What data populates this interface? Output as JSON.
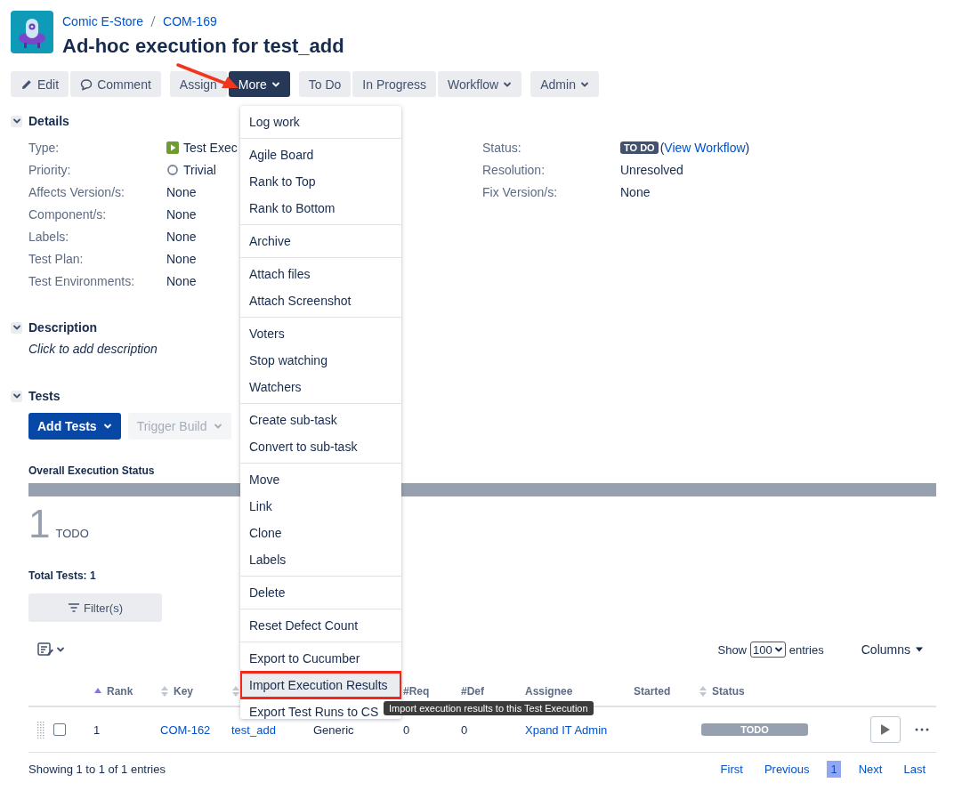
{
  "breadcrumbs": [
    "Comic E-Store",
    "COM-169"
  ],
  "title": "Ad-hoc execution for test_add",
  "toolbar": [
    {
      "buttons": [
        {
          "label": "Edit",
          "kind": "edit"
        },
        {
          "label": "Comment",
          "kind": "comment"
        }
      ]
    },
    {
      "buttons": [
        {
          "label": "Assign",
          "kind": "plain"
        },
        {
          "label": "More",
          "kind": "dropdown",
          "open": true
        }
      ]
    },
    {
      "buttons": [
        {
          "label": "To Do",
          "kind": "plain"
        },
        {
          "label": "In Progress",
          "kind": "plain"
        },
        {
          "label": "Workflow",
          "kind": "dropdown",
          "open": false
        }
      ]
    },
    {
      "buttons": [
        {
          "label": "Admin",
          "kind": "dropdown",
          "open": false
        }
      ]
    }
  ],
  "more_menu": [
    {
      "items": [
        {
          "label": "Log work",
          "highlighted": false
        }
      ]
    },
    {
      "items": [
        {
          "label": "Agile Board",
          "highlighted": false
        },
        {
          "label": "Rank to Top",
          "highlighted": false
        },
        {
          "label": "Rank to Bottom",
          "highlighted": false
        }
      ]
    },
    {
      "items": [
        {
          "label": "Archive",
          "highlighted": false
        }
      ]
    },
    {
      "items": [
        {
          "label": "Attach files",
          "highlighted": false
        },
        {
          "label": "Attach Screenshot",
          "highlighted": false
        }
      ]
    },
    {
      "items": [
        {
          "label": "Voters",
          "highlighted": false
        },
        {
          "label": "Stop watching",
          "highlighted": false
        },
        {
          "label": "Watchers",
          "highlighted": false
        }
      ]
    },
    {
      "items": [
        {
          "label": "Create sub-task",
          "highlighted": false
        },
        {
          "label": "Convert to sub-task",
          "highlighted": false
        }
      ]
    },
    {
      "items": [
        {
          "label": "Move",
          "highlighted": false
        },
        {
          "label": "Link",
          "highlighted": false
        },
        {
          "label": "Clone",
          "highlighted": false
        },
        {
          "label": "Labels",
          "highlighted": false
        }
      ]
    },
    {
      "items": [
        {
          "label": "Delete",
          "highlighted": false
        }
      ]
    },
    {
      "items": [
        {
          "label": "Reset Defect Count",
          "highlighted": false
        }
      ]
    },
    {
      "items": [
        {
          "label": "Export to Cucumber",
          "highlighted": false
        },
        {
          "label": "Import Execution Results",
          "highlighted": true
        },
        {
          "label": "Export Test Runs to CS",
          "highlighted": false
        }
      ]
    }
  ],
  "tooltip": "Import execution results to this Test Execution",
  "details": {
    "title": "Details",
    "expanded": true,
    "left": [
      {
        "label": "Type:",
        "value": "Test Exec",
        "kind": "issue-type"
      },
      {
        "label": "Priority:",
        "value": "Trivial",
        "kind": "priority"
      },
      {
        "label": "Affects Version/s:",
        "value": "None"
      },
      {
        "label": "Component/s:",
        "value": "None"
      },
      {
        "label": "Labels:",
        "value": "None"
      },
      {
        "label": "Test Plan:",
        "value": "None"
      },
      {
        "label": "Test Environments:",
        "value": "None"
      }
    ],
    "right": [
      {
        "label": "Status:",
        "kind": "status",
        "value": "TO DO",
        "prefix": "(",
        "link": "View Workflow",
        "suffix": ")"
      },
      {
        "label": "Resolution:",
        "kind": "text",
        "value": "Unresolved"
      },
      {
        "label": "Fix Version/s:",
        "kind": "text",
        "value": "None"
      }
    ]
  },
  "description": {
    "title": "Description",
    "expanded": true,
    "text": "Click to add description"
  },
  "tests": {
    "title": "Tests",
    "expanded": true,
    "buttons": [
      {
        "label": "Add Tests",
        "kind": "primary"
      },
      {
        "label": "Trigger Build",
        "kind": "disabled"
      }
    ],
    "overall_title": "Overall Execution Status",
    "overall_bar": [
      {
        "level": 1,
        "color": "#97a0af"
      }
    ],
    "count": "1",
    "count_label": "TODO",
    "total": "Total Tests: 1",
    "filter": "Filter(s)",
    "show_label": "Show",
    "page_size": "100",
    "entries_label": "entries",
    "columns_button": "Columns",
    "columns": [
      {
        "label": "Rank",
        "sortable": true,
        "sorted": true
      },
      {
        "label": "Key",
        "sortable": true,
        "sorted": false
      },
      {
        "sortable": true,
        "sorted": false
      },
      {
        "label": "#Req"
      },
      {
        "label": "#Def"
      },
      {
        "label": "Assignee"
      },
      {
        "label": "Started"
      },
      {
        "label": "Status",
        "sortable": true,
        "sorted": false
      }
    ],
    "rows": [
      {
        "checked": false,
        "rank": "1",
        "key": "COM-162",
        "column_5": "test_add",
        "column_6": "Generic",
        "req": "0",
        "def": "0",
        "assignee": "Xpand IT Admin",
        "status": "TODO",
        "color": "#97a0af"
      }
    ],
    "info": "Showing 1 to 1 of 1 entries",
    "pagination": [
      {
        "label": "First",
        "selected": false
      },
      {
        "label": "Previous",
        "selected": false
      },
      {
        "label": "1",
        "selected": true
      },
      {
        "label": "Next",
        "selected": false
      },
      {
        "label": "Last",
        "selected": false
      }
    ]
  }
}
